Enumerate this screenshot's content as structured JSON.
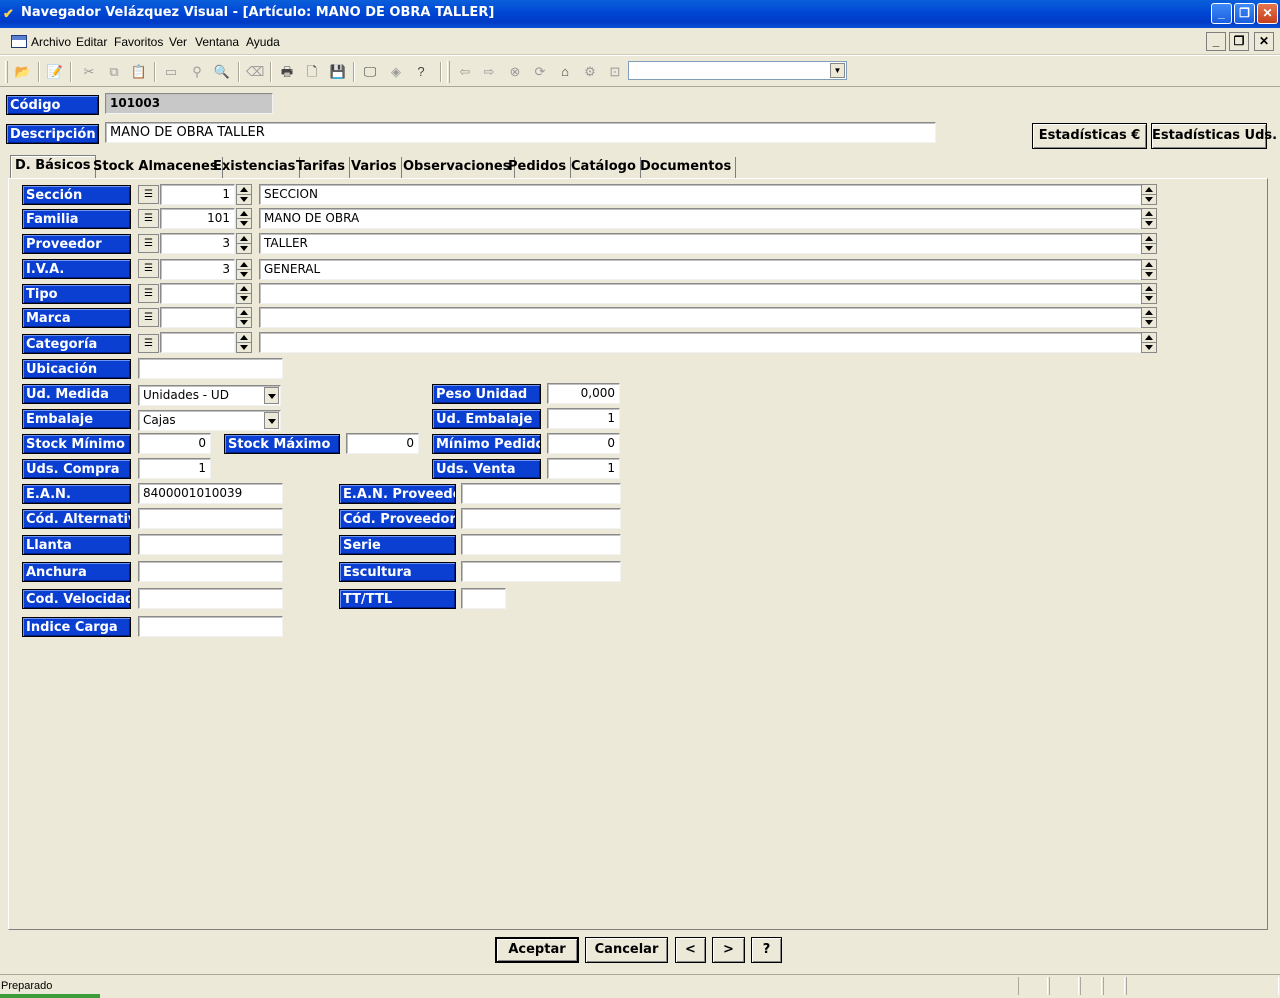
{
  "window": {
    "title": "Navegador Velázquez Visual - [Artículo: MANO DE OBRA TALLER]",
    "min": "_",
    "max": "❐",
    "close": "✕"
  },
  "menu": [
    "Archivo",
    "Editar",
    "Favoritos",
    "Ver",
    "Ventana",
    "Ayuda"
  ],
  "toolbar": {
    "combo_value": ""
  },
  "header": {
    "codigo_label": "Código",
    "codigo_value": "101003",
    "descripcion_label": "Descripción",
    "descripcion_value": "MANO DE OBRA TALLER",
    "stats_eur": "Estadísticas €",
    "stats_uds": "Estadísticas Uds."
  },
  "tabs": [
    "D. Básicos",
    "Stock Almacenes",
    "Existencias",
    "Tarifas",
    "Varios",
    "Observaciones",
    "Pedidos",
    "Catálogo",
    "Documentos"
  ],
  "lookups": [
    {
      "label": "Sección",
      "code": "1",
      "name": "SECCION"
    },
    {
      "label": "Familia",
      "code": "101",
      "name": "MANO DE OBRA"
    },
    {
      "label": "Proveedor",
      "code": "3",
      "name": "TALLER"
    },
    {
      "label": "I.V.A.",
      "code": "3",
      "name": "GENERAL"
    },
    {
      "label": "Tipo",
      "code": "",
      "name": ""
    },
    {
      "label": "Marca",
      "code": "",
      "name": ""
    },
    {
      "label": "Categoría",
      "code": "",
      "name": ""
    }
  ],
  "fields": {
    "ubicacion_label": "Ubicación",
    "ubicacion": "",
    "ud_medida_label": "Ud. Medida",
    "ud_medida": "Unidades - UD",
    "embalaje_label": "Embalaje",
    "embalaje": "Cajas",
    "stock_minimo_label": "Stock Mínimo",
    "stock_minimo": "0",
    "stock_maximo_label": "Stock Máximo",
    "stock_maximo": "0",
    "uds_compra_label": "Uds. Compra",
    "uds_compra": "1",
    "ean_label": "E.A.N.",
    "ean": "8400001010039",
    "cod_alternativo_label": "Cód. Alternativo",
    "cod_alternativo": "",
    "llanta_label": "Llanta",
    "llanta": "",
    "anchura_label": "Anchura",
    "anchura": "",
    "cod_velocidad_label": "Cod. Velocidad",
    "cod_velocidad": "",
    "indice_carga_label": "Indice Carga",
    "indice_carga": "",
    "peso_unidad_label": "Peso Unidad",
    "peso_unidad": "0,000",
    "ud_embalaje_label": "Ud. Embalaje",
    "ud_embalaje": "1",
    "minimo_pedido_label": "Mínimo Pedido",
    "minimo_pedido": "0",
    "uds_venta_label": "Uds. Venta",
    "uds_venta": "1",
    "ean_proveedor_label": "E.A.N. Proveedor",
    "ean_proveedor": "",
    "cod_proveedor_label": "Cód. Proveedor",
    "cod_proveedor": "",
    "serie_label": "Serie",
    "serie": "",
    "escultura_label": "Escultura",
    "escultura": "",
    "tt_ttl_label": "TT/TTL",
    "tt_ttl": ""
  },
  "buttons": {
    "aceptar": "Aceptar",
    "cancelar": "Cancelar",
    "prev": "<",
    "next": ">",
    "help": "?"
  },
  "status": {
    "text": "Preparado"
  }
}
